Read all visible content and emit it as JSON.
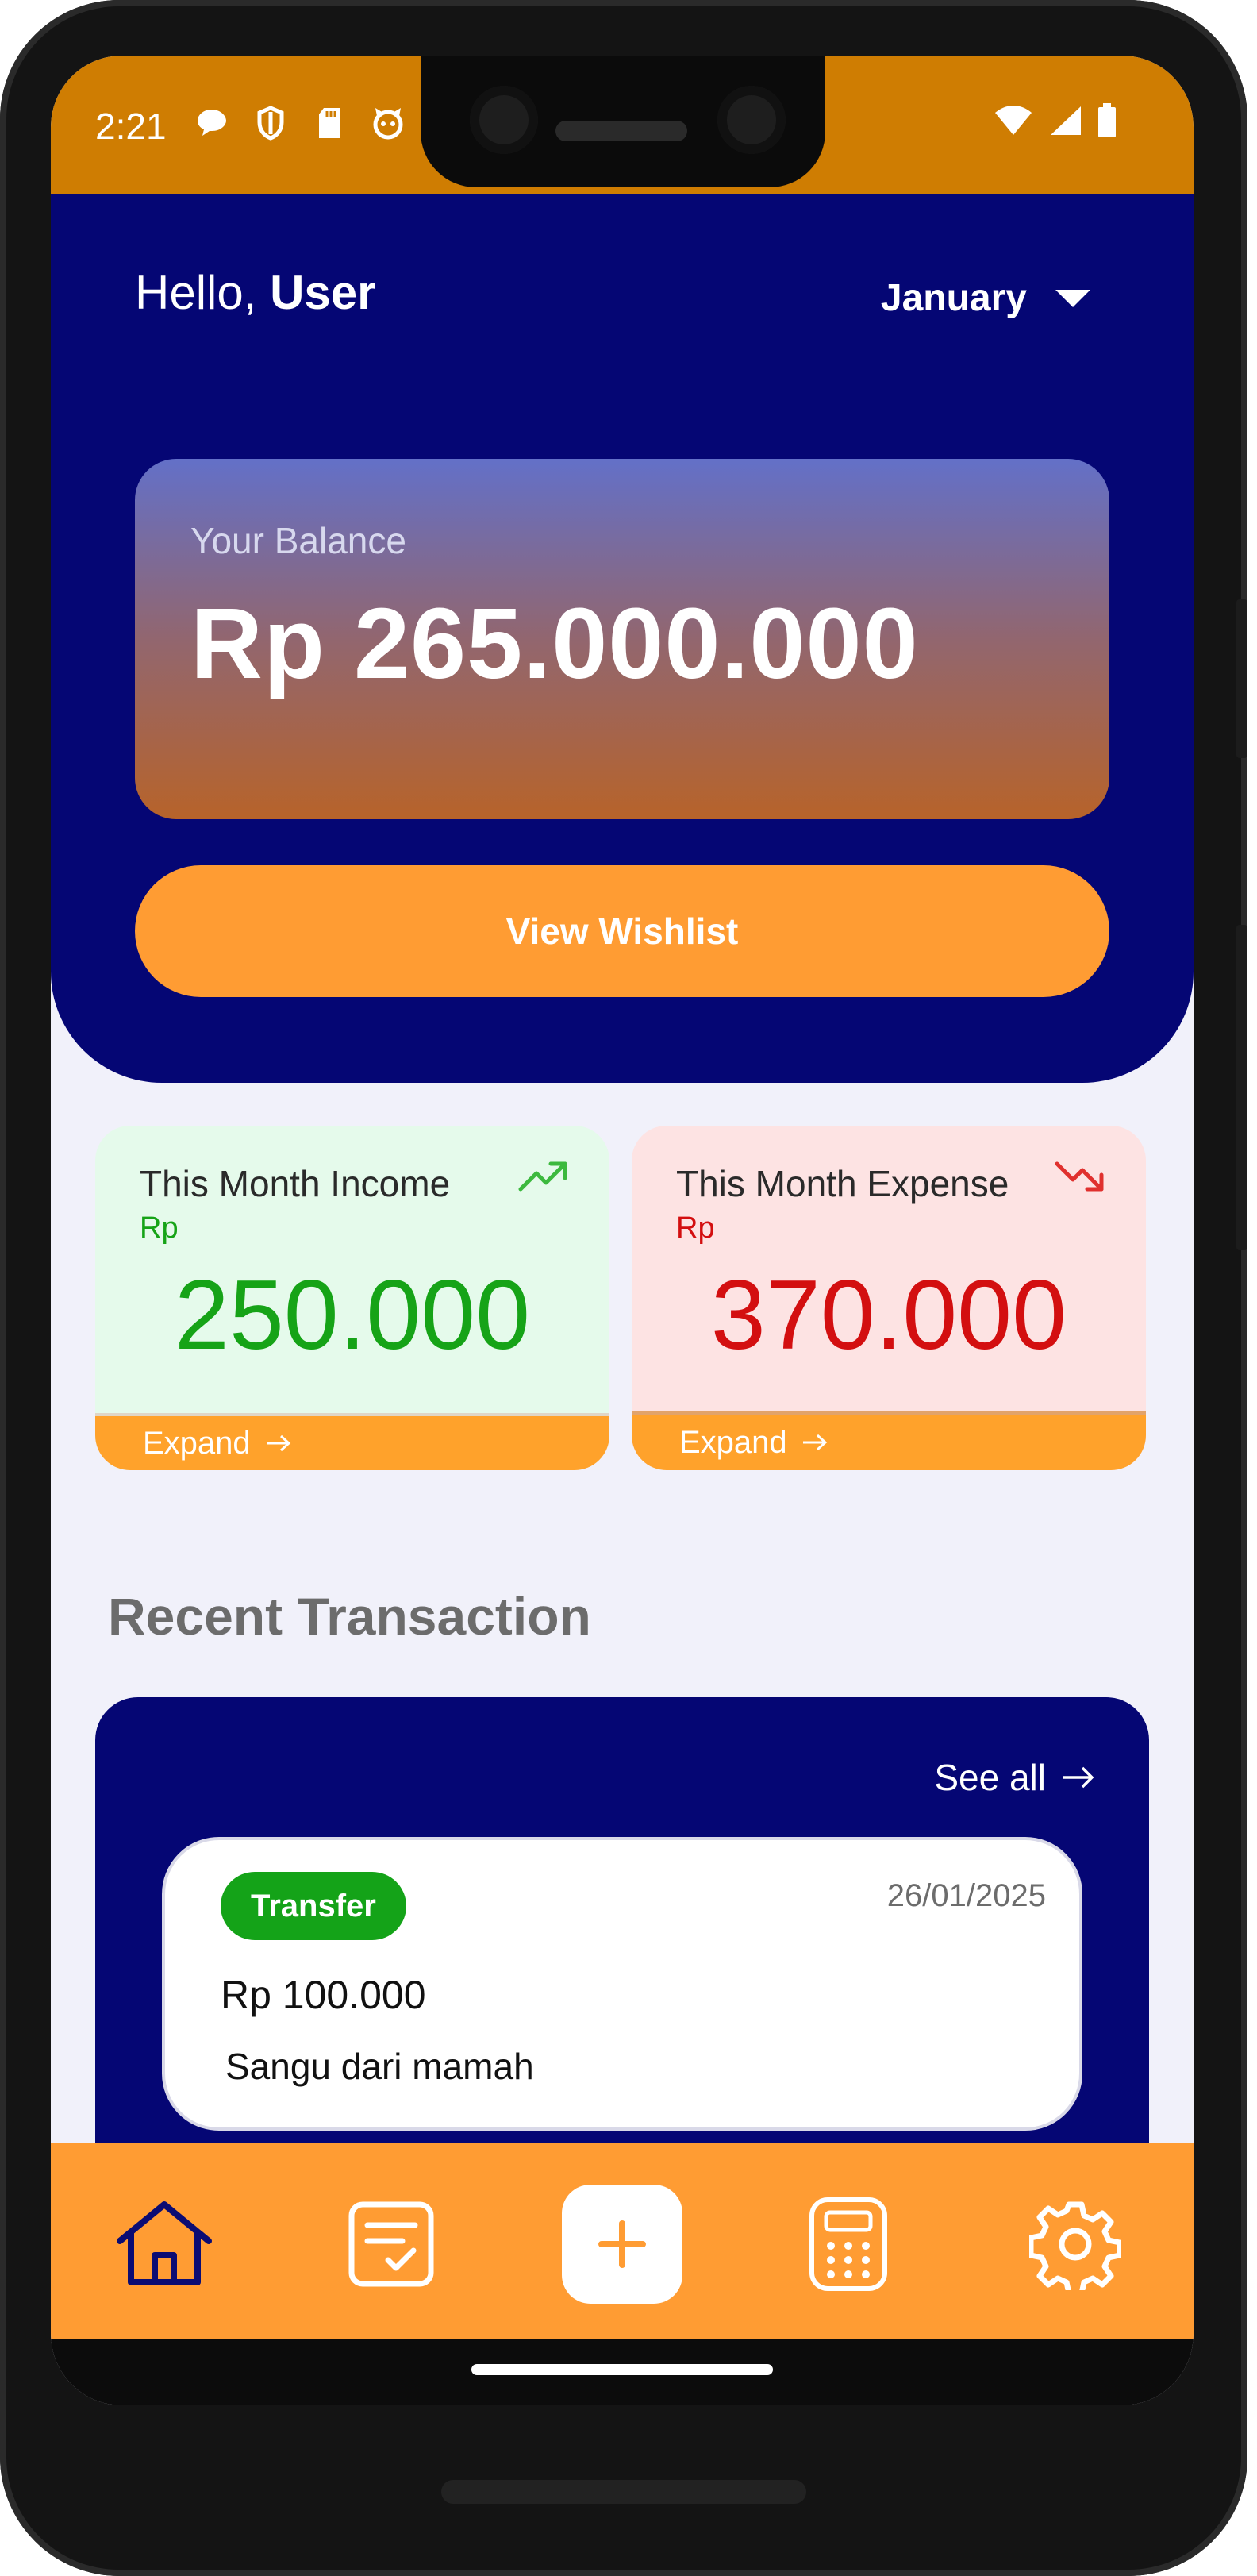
{
  "status_bar": {
    "time": "2:21",
    "left_icons": [
      "chat-icon",
      "shield-icon",
      "sd-card-icon",
      "cat-face-icon"
    ],
    "right_icons": [
      "wifi-icon",
      "signal-icon",
      "battery-icon"
    ],
    "background": "#CF7D02"
  },
  "header": {
    "greeting_prefix": "Hello, ",
    "user_name": "User",
    "month": "January",
    "background": "#050674"
  },
  "balance": {
    "label": "Your Balance",
    "value": "Rp 265.000.000"
  },
  "wishlist_button": {
    "label": "View Wishlist",
    "color": "#FF9C33"
  },
  "income": {
    "title": "This Month Income",
    "currency": "Rp",
    "value": "250.000",
    "expand_label": "Expand",
    "color": "#16A317",
    "icon": "trending-up-icon"
  },
  "expense": {
    "title": "This Month Expense",
    "currency": "Rp",
    "value": "370.000",
    "expand_label": "Expand",
    "color": "#D30F10",
    "icon": "trending-down-icon"
  },
  "recent": {
    "title": "Recent Transaction",
    "see_all_label": "See all",
    "transactions": [
      {
        "type": "Transfer",
        "date": "26/01/2025",
        "amount": "Rp 100.000",
        "description": "Sangu dari mamah"
      }
    ]
  },
  "bottom_nav": {
    "items": [
      "home-icon",
      "tasks-icon",
      "plus-icon",
      "calculator-icon",
      "settings-icon"
    ],
    "active": "home-icon",
    "background": "#FF9C33"
  }
}
